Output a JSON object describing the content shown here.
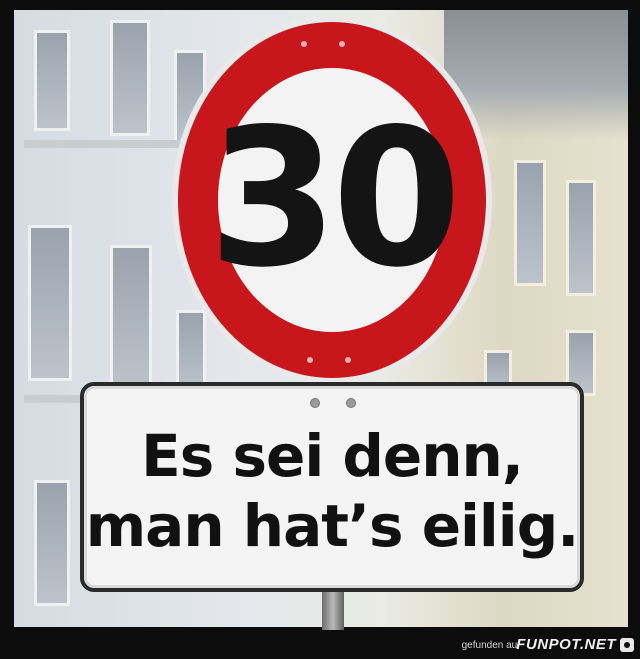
{
  "speed_limit_sign": {
    "number": "30",
    "ring_color": "#c8161d",
    "face_color": "#f3f3f3"
  },
  "supplementary_sign": {
    "line1": "Es sei denn,",
    "line2": "man hat’s eilig."
  },
  "footer": {
    "credit": "gefunden auf",
    "brand": "FUNPOT.NET"
  }
}
